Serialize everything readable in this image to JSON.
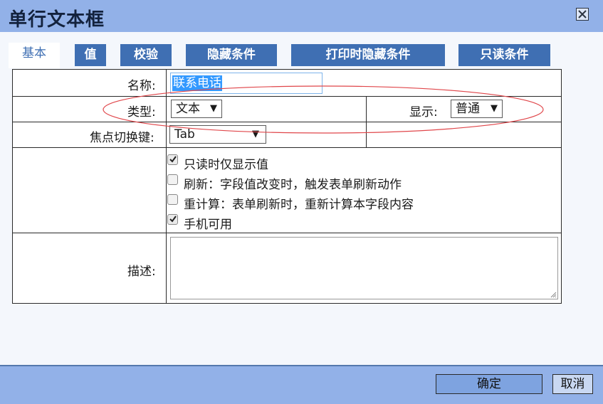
{
  "window": {
    "title": "单行文本框",
    "close_icon": "close-x-icon"
  },
  "tabs": [
    {
      "label": "基本",
      "active": true
    },
    {
      "label": "值"
    },
    {
      "label": "校验"
    },
    {
      "label": "隐藏条件"
    },
    {
      "label": "打印时隐藏条件"
    },
    {
      "label": "只读条件"
    }
  ],
  "form": {
    "name_label": "名称:",
    "name_value": "联系电话",
    "type_label": "类型:",
    "type_value": "文本",
    "display_label": "显示:",
    "display_value": "普通",
    "focus_key_label": "焦点切换键:",
    "focus_key_value": "Tab",
    "checkboxes": [
      {
        "label": "只读时仅显示值",
        "checked": true
      },
      {
        "label": "刷新：字段值改变时，触发表单刷新动作",
        "checked": false
      },
      {
        "label": "重计算：表单刷新时，重新计算本字段内容",
        "checked": false
      },
      {
        "label": "手机可用",
        "checked": true
      }
    ],
    "description_label": "描述:",
    "description_value": ""
  },
  "footer": {
    "ok_label": "确定",
    "cancel_label": "取消"
  },
  "colors": {
    "accent": "#3f6fb3",
    "titlebar": "#92b1e8",
    "annotation": "#e0464a"
  }
}
